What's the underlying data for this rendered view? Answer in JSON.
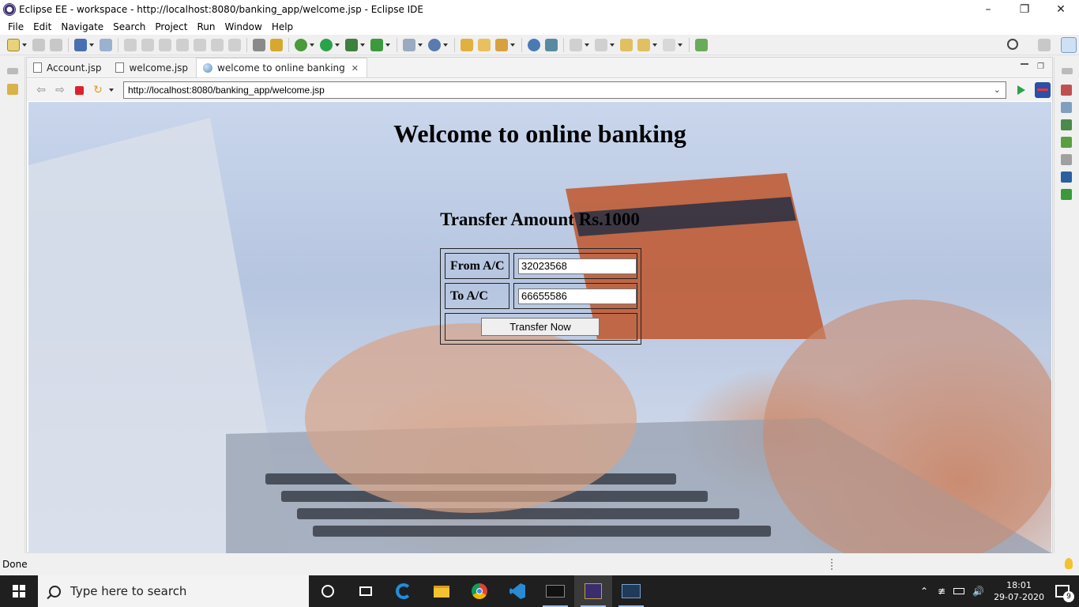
{
  "window": {
    "title": "Eclipse EE - workspace - http://localhost:8080/banking_app/welcome.jsp - Eclipse IDE"
  },
  "menu": [
    "File",
    "Edit",
    "Navigate",
    "Search",
    "Project",
    "Run",
    "Window",
    "Help"
  ],
  "tabs": [
    {
      "label": "Account.jsp"
    },
    {
      "label": "welcome.jsp"
    },
    {
      "label": "welcome to online banking"
    }
  ],
  "browser": {
    "url": "http://localhost:8080/banking_app/welcome.jsp"
  },
  "page": {
    "heading": "Welcome to online banking",
    "transfer_heading": "Transfer Amount Rs.1000",
    "from_label": "From A/C",
    "from_value": "32023568",
    "to_label": "To A/C",
    "to_value": "66655586",
    "submit_label": "Transfer Now"
  },
  "status": {
    "text": "Done"
  },
  "taskbar": {
    "search_placeholder": "Type here to search",
    "time": "18:01",
    "date": "29-07-2020",
    "notification_count": "9"
  },
  "colors": {
    "accent_green": "#2aa24a",
    "stop_red": "#e0202a",
    "taskbar": "#1f1f1f"
  }
}
